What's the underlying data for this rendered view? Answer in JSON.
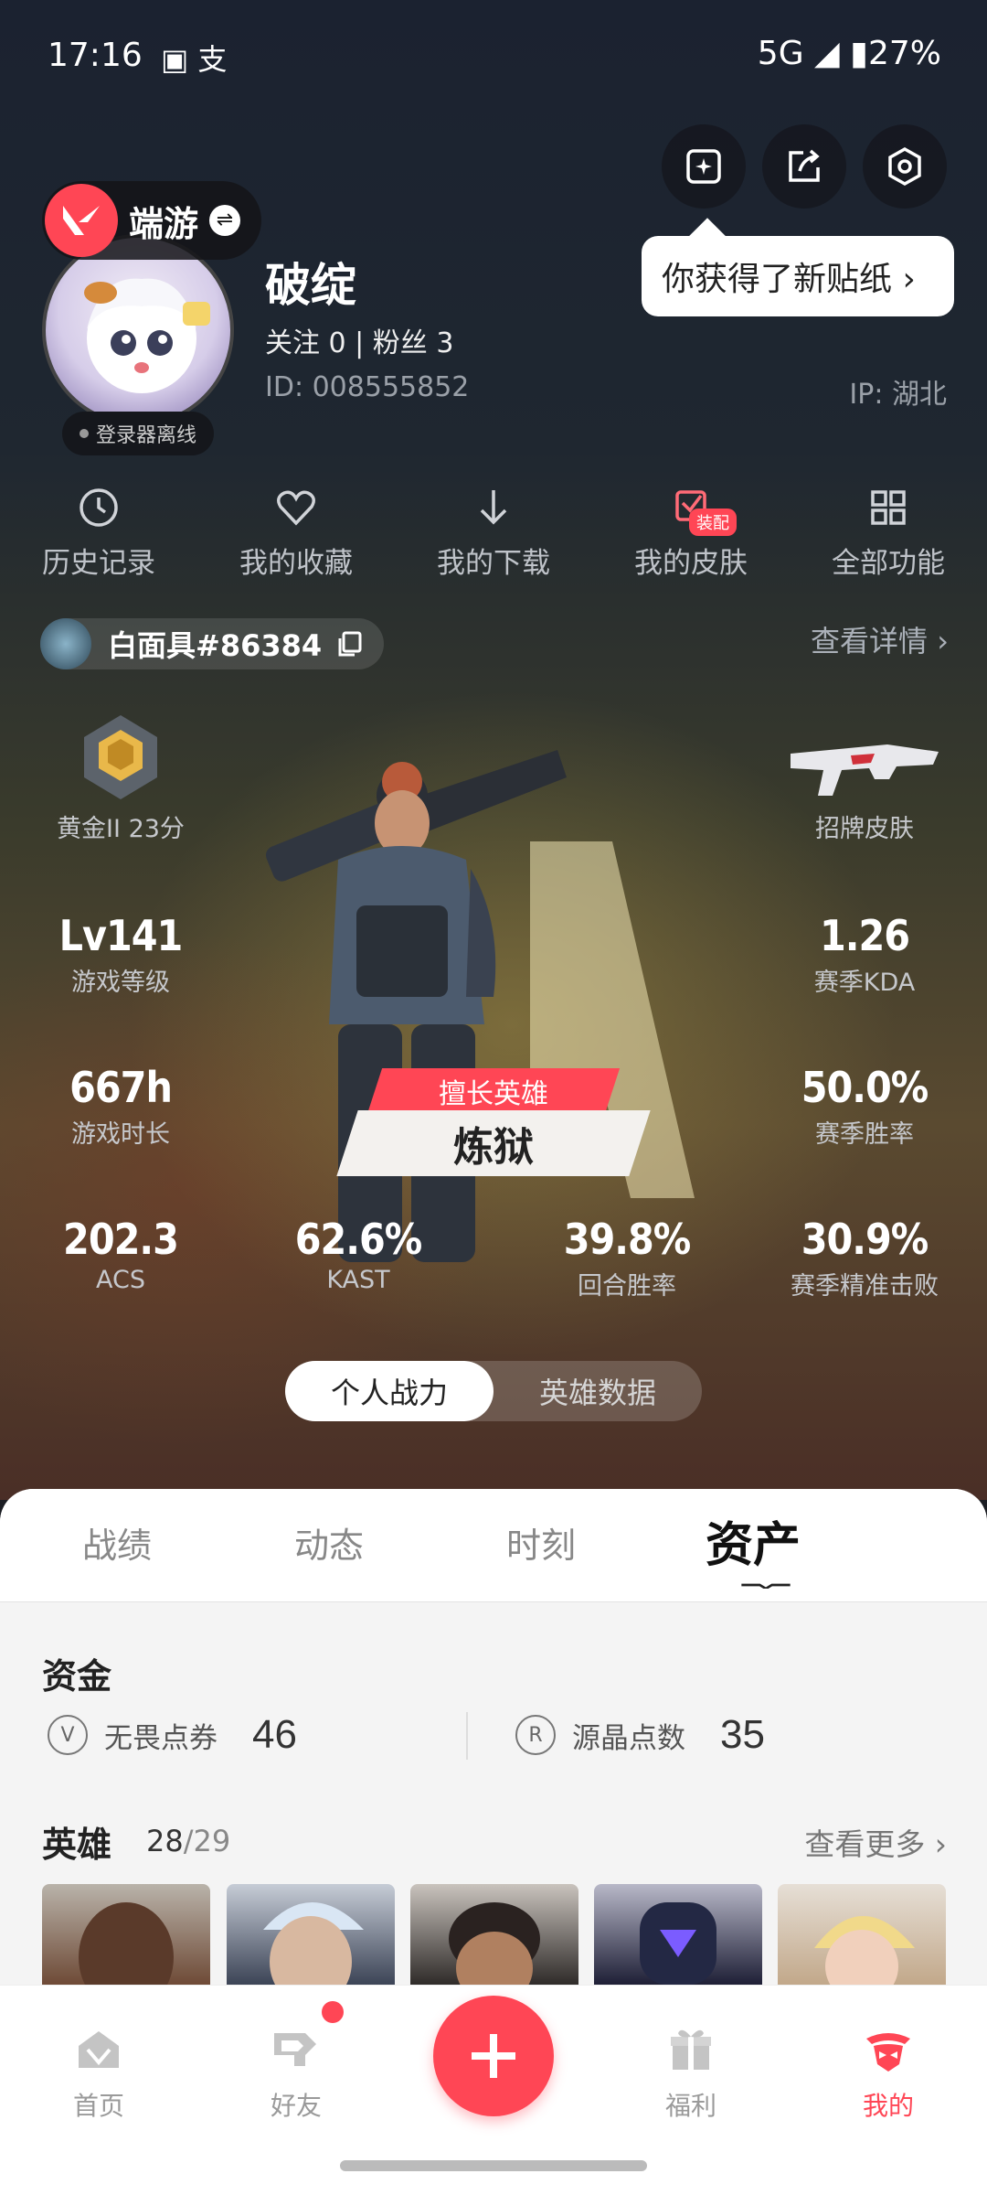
{
  "status_bar": {
    "time": "17:16",
    "left_icons": "▣ 支",
    "right": "5G ◢ ▮27%"
  },
  "header": {
    "game_name": "端游",
    "tooltip": "你获得了新贴纸 ›",
    "status_chip": "登录器离线",
    "username": "破绽",
    "follow_text": "关注 0   |   粉丝 3",
    "uid": "ID:  008555852",
    "ip": "IP:  湖北"
  },
  "quick_actions": [
    {
      "label": "历史记录",
      "icon": "history-icon"
    },
    {
      "label": "我的收藏",
      "icon": "heart-icon"
    },
    {
      "label": "我的下载",
      "icon": "download-icon"
    },
    {
      "label": "我的皮肤",
      "icon": "skin-icon",
      "badge": "装配"
    },
    {
      "label": "全部功能",
      "icon": "grid-icon"
    }
  ],
  "riot": {
    "name": "白面具#86384",
    "view_detail": "查看详情 ›"
  },
  "stats": {
    "rank_label": "黄金II 23分",
    "skin_label": "招牌皮肤",
    "level_value": "Lv141",
    "level_label": "游戏等级",
    "kda_value": "1.26",
    "kda_label": "赛季KDA",
    "hours_value": "667h",
    "hours_label": "游戏时长",
    "winrate_value": "50.0%",
    "winrate_label": "赛季胜率",
    "acs_value": "202.3",
    "acs_label": "ACS",
    "kast_value": "62.6%",
    "kast_label": "KAST",
    "round_value": "39.8%",
    "round_label": "回合胜率",
    "precise_value": "30.9%",
    "precise_label": "赛季精准击败"
  },
  "signature_agent": {
    "tag": "擅长英雄",
    "name": "炼狱"
  },
  "toggle": {
    "active": "个人战力",
    "inactive": "英雄数据"
  },
  "tabs": [
    "战绩",
    "动态",
    "时刻",
    "资产"
  ],
  "funds": {
    "title": "资金",
    "vp_label": "无畏点券",
    "vp_amount": "46",
    "rp_label": "源晶点数",
    "rp_amount": "35"
  },
  "heroes": {
    "title": "英雄",
    "owned": "28",
    "total": "/29",
    "see_more": "查看更多 ›"
  },
  "nav": {
    "home": "首页",
    "friends": "好友",
    "welfare": "福利",
    "mine": "我的"
  },
  "colors": {
    "accent": "#ff4655",
    "sheet": "#f4f4f4"
  }
}
